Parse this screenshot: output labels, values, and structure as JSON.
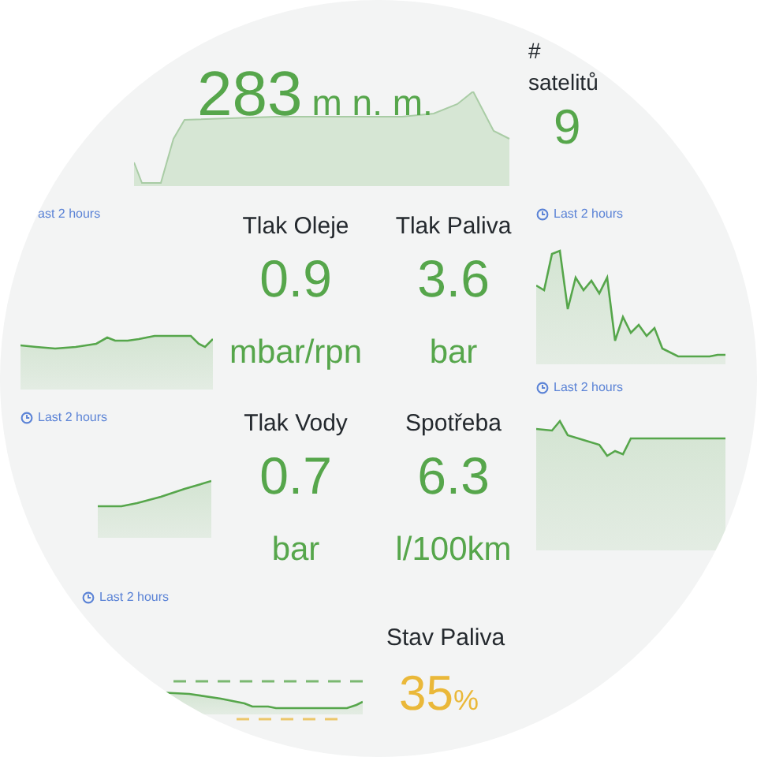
{
  "altitude": {
    "value": "283",
    "unit": "m n. m."
  },
  "satellites": {
    "title": "# satelitů",
    "value": "9"
  },
  "left_charts": [
    {
      "time_label": "ast 2 hours",
      "clock_icon": false
    },
    {
      "time_label": "Last 2 hours",
      "clock_icon": true
    },
    {
      "time_label": "Last 2 hours",
      "clock_icon": true
    }
  ],
  "right_charts": [
    {
      "time_label": "Last 2 hours",
      "clock_icon": true
    },
    {
      "time_label": "Last 2 hours",
      "clock_icon": true
    }
  ],
  "stats": [
    {
      "title": "Tlak Oleje",
      "value": "0.9",
      "unit": "mbar/rpn",
      "color": "#56a64b"
    },
    {
      "title": "Tlak Paliva",
      "value": "3.6",
      "unit": "bar",
      "color": "#56a64b"
    },
    {
      "title": "Tlak Vody",
      "value": "0.7",
      "unit": "bar",
      "color": "#56a64b"
    },
    {
      "title": "Spotřeba",
      "value": "6.3",
      "unit": "l/100km",
      "color": "#56a64b"
    }
  ],
  "fuel": {
    "title": "Stav Paliva",
    "value": "35",
    "unit": "%",
    "color": "#eab839"
  }
}
